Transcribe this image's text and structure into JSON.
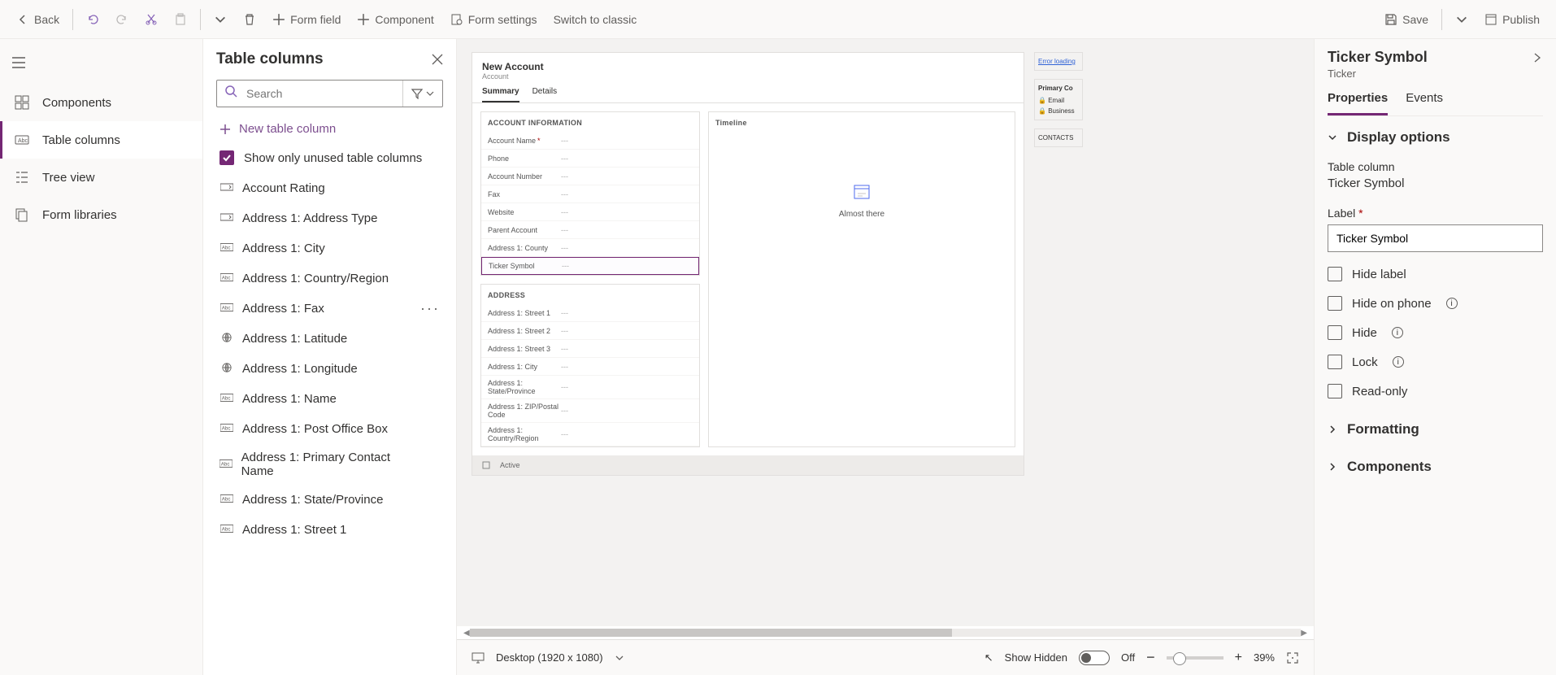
{
  "toolbar": {
    "back": "Back",
    "form_field": "Form field",
    "component": "Component",
    "form_settings": "Form settings",
    "switch_classic": "Switch to classic",
    "save": "Save",
    "publish": "Publish"
  },
  "leftnav": {
    "items": [
      {
        "id": "components",
        "label": "Components"
      },
      {
        "id": "tablecols",
        "label": "Table columns"
      },
      {
        "id": "treeview",
        "label": "Tree view"
      },
      {
        "id": "formlib",
        "label": "Form libraries"
      }
    ]
  },
  "tablecols": {
    "title": "Table columns",
    "search_placeholder": "Search",
    "new_column": "New table column",
    "show_unused": "Show only unused table columns",
    "columns": [
      {
        "type": "option",
        "label": "Account Rating"
      },
      {
        "type": "option",
        "label": "Address 1: Address Type"
      },
      {
        "type": "text",
        "label": "Address 1: City"
      },
      {
        "type": "text",
        "label": "Address 1: Country/Region"
      },
      {
        "type": "text",
        "label": "Address 1: Fax",
        "hover": true
      },
      {
        "type": "globe",
        "label": "Address 1: Latitude"
      },
      {
        "type": "globe",
        "label": "Address 1: Longitude"
      },
      {
        "type": "text",
        "label": "Address 1: Name"
      },
      {
        "type": "text",
        "label": "Address 1: Post Office Box"
      },
      {
        "type": "text",
        "label": "Address 1: Primary Contact Name"
      },
      {
        "type": "text",
        "label": "Address 1: State/Province"
      },
      {
        "type": "text",
        "label": "Address 1: Street 1"
      }
    ]
  },
  "form": {
    "title": "New Account",
    "subtitle": "Account",
    "tabs": [
      "Summary",
      "Details"
    ],
    "section1": {
      "title": "ACCOUNT INFORMATION",
      "fields": [
        {
          "label": "Account Name",
          "required": true
        },
        {
          "label": "Phone"
        },
        {
          "label": "Account Number"
        },
        {
          "label": "Fax"
        },
        {
          "label": "Website"
        },
        {
          "label": "Parent Account"
        },
        {
          "label": "Address 1: County"
        },
        {
          "label": "Ticker Symbol",
          "selected": true
        }
      ]
    },
    "section2": {
      "title": "ADDRESS",
      "fields": [
        {
          "label": "Address 1: Street 1"
        },
        {
          "label": "Address 1: Street 2"
        },
        {
          "label": "Address 1: Street 3"
        },
        {
          "label": "Address 1: City"
        },
        {
          "label": "Address 1: State/Province"
        },
        {
          "label": "Address 1: ZIP/Postal Code"
        },
        {
          "label": "Address 1: Country/Region"
        }
      ]
    },
    "timeline": {
      "title": "Timeline",
      "status": "Almost there"
    },
    "right_cards": {
      "error": "Error loading",
      "primary": "Primary Co",
      "email": "Email",
      "business": "Business",
      "contacts": "CONTACTS"
    },
    "status_bar": "Active"
  },
  "canvas_footer": {
    "viewport": "Desktop (1920 x 1080)",
    "show_hidden": "Show Hidden",
    "toggle_state": "Off",
    "zoom": "39%"
  },
  "props": {
    "title": "Ticker Symbol",
    "subtitle": "Ticker",
    "tabs": [
      "Properties",
      "Events"
    ],
    "display_options": "Display options",
    "table_column_label": "Table column",
    "table_column_value": "Ticker Symbol",
    "label_label": "Label",
    "label_value": "Ticker Symbol",
    "checks": {
      "hide_label": "Hide label",
      "hide_phone": "Hide on phone",
      "hide": "Hide",
      "lock": "Lock",
      "readonly": "Read-only"
    },
    "formatting": "Formatting",
    "components": "Components"
  }
}
